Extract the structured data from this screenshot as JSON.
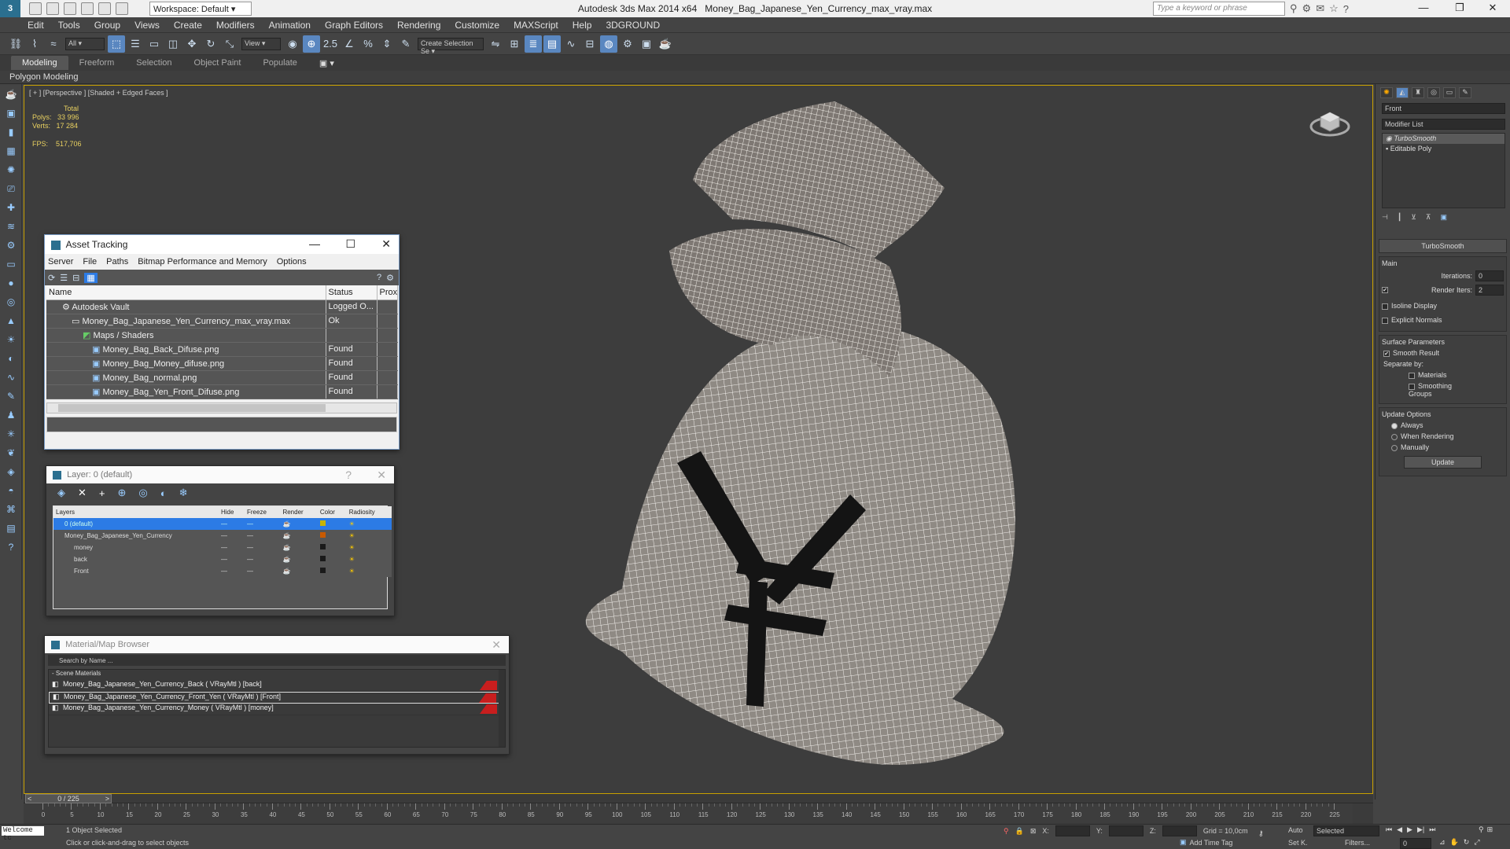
{
  "titlebar": {
    "workspace": "Workspace: Default",
    "app": "Autodesk 3ds Max  2014 x64",
    "file": "Money_Bag_Japanese_Yen_Currency_max_vray.max",
    "keyword_placeholder": "Type a keyword or phrase"
  },
  "menu": [
    "Edit",
    "Tools",
    "Group",
    "Views",
    "Create",
    "Modifiers",
    "Animation",
    "Graph Editors",
    "Rendering",
    "Customize",
    "MAXScript",
    "Help",
    "3DGROUND"
  ],
  "toolbar": {
    "filter": "All",
    "refcoord": "View",
    "selset": "Create Selection Se"
  },
  "ribbon": {
    "tabs": [
      "Modeling",
      "Freeform",
      "Selection",
      "Object Paint",
      "Populate"
    ],
    "sub": "Polygon Modeling"
  },
  "viewport": {
    "label": "[ + ] [Perspective ] [Shaded + Edged Faces ]",
    "total": "Total",
    "polys_label": "Polys:",
    "polys": "33 996",
    "verts_label": "Verts:",
    "verts": "17 284",
    "fps_label": "FPS:",
    "fps": "517,706"
  },
  "asset_tracking": {
    "title": "Asset Tracking",
    "menu": [
      "Server",
      "File",
      "Paths",
      "Bitmap Performance and Memory",
      "Options"
    ],
    "cols": [
      "Name",
      "Status",
      "Prox"
    ],
    "rows": [
      {
        "name": "Autodesk Vault",
        "status": "Logged O..."
      },
      {
        "name": "Money_Bag_Japanese_Yen_Currency_max_vray.max",
        "status": "Ok"
      },
      {
        "name": "Maps / Shaders",
        "status": ""
      },
      {
        "name": "Money_Bag_Back_Difuse.png",
        "status": "Found"
      },
      {
        "name": "Money_Bag_Money_difuse.png",
        "status": "Found"
      },
      {
        "name": "Money_Bag_normal.png",
        "status": "Found"
      },
      {
        "name": "Money_Bag_Yen_Front_Difuse.png",
        "status": "Found"
      }
    ]
  },
  "layer_dialog": {
    "title": "Layer: 0 (default)",
    "help": "?",
    "cols": [
      "Layers",
      "Hide",
      "Freeze",
      "Render",
      "Color",
      "Radiosity"
    ],
    "rows": [
      {
        "name": "0 (default)",
        "color": "#c8b400"
      },
      {
        "name": "Money_Bag_Japanese_Yen_Currency",
        "color": "#c85a00"
      },
      {
        "name": "money",
        "color": "#1a1a1a"
      },
      {
        "name": "back",
        "color": "#1a1a1a"
      },
      {
        "name": "Front",
        "color": "#1a1a1a"
      }
    ]
  },
  "material_browser": {
    "title": "Material/Map Browser",
    "search_placeholder": "Search by Name ...",
    "group": "- Scene Materials",
    "items": [
      "Money_Bag_Japanese_Yen_Currency_Back  ( VRayMtl )  [back]",
      "Money_Bag_Japanese_Yen_Currency_Front_Yen  ( VRayMtl )  [Front]",
      "Money_Bag_Japanese_Yen_Currency_Money  ( VRayMtl )  [money]"
    ]
  },
  "command_panel": {
    "object_name": "Front",
    "modifier_list": "Modifier List",
    "stack": [
      "TurboSmooth",
      "Editable Poly"
    ],
    "rollout": "TurboSmooth",
    "main": "Main",
    "iterations_label": "Iterations:",
    "iterations": "0",
    "render_iters_label": "Render Iters:",
    "render_iters": "2",
    "isoline": "Isoline Display",
    "explicit": "Explicit Normals",
    "surface": "Surface Parameters",
    "smooth_result": "Smooth Result",
    "separate": "Separate by:",
    "materials": "Materials",
    "smoothing_groups": "Smoothing Groups",
    "update_options": "Update Options",
    "always": "Always",
    "when_rendering": "When Rendering",
    "manually": "Manually",
    "update_btn": "Update"
  },
  "timeline": {
    "frame": "0 / 225",
    "ticks": [
      "0",
      "5",
      "10",
      "15",
      "20",
      "25",
      "30",
      "35",
      "40",
      "45",
      "50",
      "55",
      "60",
      "65",
      "70",
      "75",
      "80",
      "85",
      "90",
      "95",
      "100",
      "105",
      "110",
      "115",
      "120",
      "125",
      "130",
      "135",
      "140",
      "145",
      "150",
      "155",
      "160",
      "165",
      "170",
      "175",
      "180",
      "185",
      "190",
      "195",
      "200",
      "205",
      "210",
      "215",
      "220",
      "225"
    ]
  },
  "status": {
    "welcome": "Welcome tc",
    "selected": "1 Object Selected",
    "hint": "Click or click-and-drag to select objects",
    "x_label": "X:",
    "y_label": "Y:",
    "z_label": "Z:",
    "grid": "Grid = 10,0cm",
    "add_time_tag": "Add Time Tag",
    "auto": "Auto",
    "set_k": "Set K.",
    "selected_dd": "Selected",
    "filters": "Filters...",
    "frame": "0"
  }
}
